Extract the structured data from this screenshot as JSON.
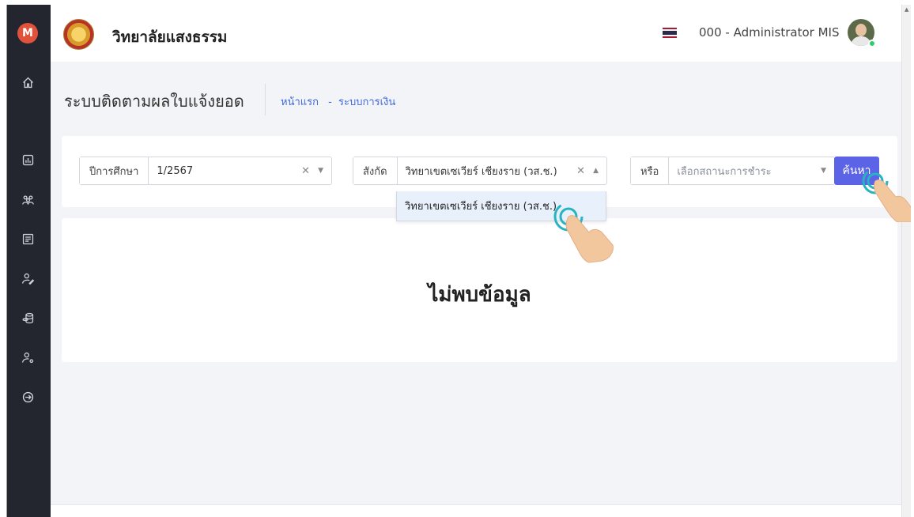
{
  "app": {
    "logo_letter": "M",
    "school_name": "วิทยาลัยแสงธรรม",
    "user_name": "000 - Administrator MIS"
  },
  "sidebar": {
    "icons": [
      "home-icon",
      "report-icon",
      "users-icon",
      "list-icon",
      "user-edit-icon",
      "coins-icon",
      "user-settings-icon",
      "logout-icon"
    ]
  },
  "page": {
    "title": "ระบบติดตามผลใบแจ้งยอด",
    "breadcrumb": [
      "หน้าแรก",
      "ระบบการเงิน"
    ],
    "breadcrumb_sep": "-"
  },
  "filters": {
    "year": {
      "label": "ปีการศึกษา",
      "value": "1/2567"
    },
    "affiliation": {
      "label": "สังกัด",
      "value": "วิทยาเขตเซเวียร์ เชียงราย (วส.ช.)"
    },
    "status": {
      "label": "หรือ",
      "placeholder": "เลือกสถานะการชำระ"
    },
    "search_label": "ค้นหา"
  },
  "dropdown": {
    "options": [
      "วิทยาเขตเซเวียร์ เชียงราย (วส.ช.)"
    ]
  },
  "result": {
    "message": "ไม่พบข้อมูล"
  },
  "colors": {
    "sidebar": "#24262f",
    "accent": "#5b63e6",
    "link": "#3f6ad8",
    "logo": "#e0533a"
  }
}
